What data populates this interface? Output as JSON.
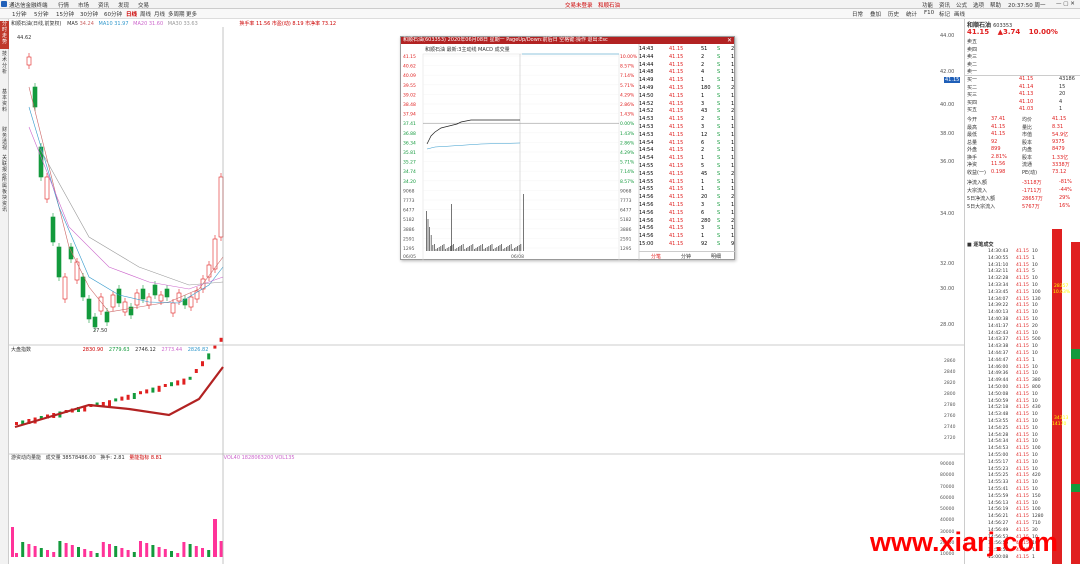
{
  "titlebar": {
    "app": "通达信金融终端",
    "menus": [
      "行情",
      "市场",
      "资讯",
      "发现",
      "交易"
    ],
    "tab_active": "交易未登录",
    "tab_other": "和顺石油",
    "right": [
      "功能",
      "资讯",
      "公式",
      "选项",
      "帮助"
    ],
    "time": "20:37:50 周一"
  },
  "toolbar": {
    "periods": [
      "1分钟",
      "5分钟",
      "15分钟",
      "30分钟",
      "60分钟",
      "日线",
      "周线",
      "月线",
      "多周期",
      "更多"
    ],
    "active": "日线",
    "right": [
      "日常",
      "叠加",
      "历史",
      "统计",
      "F10",
      "标记",
      "画线"
    ]
  },
  "stock": {
    "name": "和顺石油",
    "code": "603353",
    "price": "41.15",
    "change": "3.74",
    "pct": "10.00%"
  },
  "leftbar": {
    "tabs": [
      "分时走势",
      "技术分析",
      "基本资料",
      "财务透视",
      "关联报价",
      "所属板块",
      "资讯"
    ]
  },
  "main_chart": {
    "label": "和顺石油(日线,前复权)",
    "ma": [
      {
        "name": "MA5",
        "value": "34.24",
        "color": "#c66"
      },
      {
        "name": "MA10",
        "value": "31.97",
        "color": "#39c"
      },
      {
        "name": "MA20",
        "value": "31.60",
        "color": "#c6c"
      },
      {
        "name": "MA30",
        "value": "33.63",
        "color": "#999"
      }
    ],
    "right_info": "换手率 11.56  市盈(动) 8.19  市净率 73.12",
    "high_label": "44.62",
    "low_label": "27.50",
    "yaxis": [
      "44.00",
      "42.00",
      "40.00",
      "38.00",
      "36.00",
      "34.00",
      "32.00",
      "30.00",
      "28.00"
    ],
    "cur": "41.15"
  },
  "index_chart": {
    "label": "大盘指数",
    "v1": "2830.90",
    "v2": "2779.63",
    "v3": "2746.12",
    "v4": "2773.44",
    "v5": "2826.82",
    "yaxis": [
      "2860",
      "2840",
      "2820",
      "2800",
      "2780",
      "2760",
      "2740",
      "2720",
      "2700"
    ]
  },
  "vol_chart": {
    "label": "游资动向量能",
    "v1": "成交量",
    "v2": "38578486.00",
    "v3": "换手:",
    "v4": "2.81",
    "v5": "量能指标",
    "v6": "8.81",
    "v7": "VOL40",
    "v8": "1828063200",
    "v9": "VOL135",
    "yaxis": [
      "90000",
      "80000",
      "70000",
      "60000",
      "50000",
      "40000",
      "30000",
      "20000",
      "10000"
    ]
  },
  "popup": {
    "title": "和顺石油(603353) 2020年06月08日 星期一 PageUp/Down:前后日 空格键:操作 退出:Esc",
    "legend": "和顺石油  最新:3主动线  MACD  成交量",
    "ylabels": [
      {
        "v": "41.15",
        "p": "10.00%"
      },
      {
        "v": "40.62",
        "p": "8.57%"
      },
      {
        "v": "40.09",
        "p": "7.14%"
      },
      {
        "v": "39.55",
        "p": "5.71%"
      },
      {
        "v": "39.02",
        "p": "4.29%"
      },
      {
        "v": "38.48",
        "p": "2.86%"
      },
      {
        "v": "37.94",
        "p": "1.43%"
      },
      {
        "v": "37.41",
        "p": "0.00%"
      },
      {
        "v": "36.88",
        "p": "1.43%"
      },
      {
        "v": "36.34",
        "p": "2.86%"
      },
      {
        "v": "35.81",
        "p": "4.29%"
      },
      {
        "v": "35.27",
        "p": "5.71%"
      },
      {
        "v": "34.74",
        "p": "7.14%"
      },
      {
        "v": "34.20",
        "p": "8.57%"
      },
      {
        "v": "9068",
        "p": "9068"
      },
      {
        "v": "7773",
        "p": "7773"
      },
      {
        "v": "6477",
        "p": "6477"
      },
      {
        "v": "5182",
        "p": "5182"
      },
      {
        "v": "3886",
        "p": "3886"
      },
      {
        "v": "2591",
        "p": "2591"
      },
      {
        "v": "1295",
        "p": "1295"
      }
    ],
    "xlabels": [
      "06/05",
      "06/08"
    ],
    "ticks": [
      [
        "14:43",
        "41.15",
        "51",
        "S",
        "2"
      ],
      [
        "14:44",
        "41.15",
        "2",
        "S",
        "1"
      ],
      [
        "14:44",
        "41.15",
        "2",
        "S",
        "1"
      ],
      [
        "14:48",
        "41.15",
        "4",
        "S",
        "1"
      ],
      [
        "14:49",
        "41.15",
        "1",
        "S",
        "1"
      ],
      [
        "14:49",
        "41.15",
        "180",
        "S",
        "2"
      ],
      [
        "14:50",
        "41.15",
        "1",
        "S",
        "1"
      ],
      [
        "14:52",
        "41.15",
        "3",
        "S",
        "1"
      ],
      [
        "14:52",
        "41.15",
        "43",
        "S",
        "2"
      ],
      [
        "14:53",
        "41.15",
        "2",
        "S",
        "1"
      ],
      [
        "14:53",
        "41.15",
        "3",
        "S",
        "1"
      ],
      [
        "14:53",
        "41.15",
        "12",
        "S",
        "1"
      ],
      [
        "14:54",
        "41.15",
        "6",
        "S",
        "1"
      ],
      [
        "14:54",
        "41.15",
        "2",
        "S",
        "1"
      ],
      [
        "14:54",
        "41.15",
        "1",
        "S",
        "1"
      ],
      [
        "14:55",
        "41.15",
        "5",
        "S",
        "1"
      ],
      [
        "14:55",
        "41.15",
        "45",
        "S",
        "2"
      ],
      [
        "14:55",
        "41.15",
        "1",
        "S",
        "1"
      ],
      [
        "14:55",
        "41.15",
        "1",
        "S",
        "1"
      ],
      [
        "14:56",
        "41.15",
        "20",
        "S",
        "2"
      ],
      [
        "14:56",
        "41.15",
        "3",
        "S",
        "1"
      ],
      [
        "14:56",
        "41.15",
        "6",
        "S",
        "1"
      ],
      [
        "14:56",
        "41.15",
        "280",
        "S",
        "2"
      ],
      [
        "14:56",
        "41.15",
        "3",
        "S",
        "1"
      ],
      [
        "14:56",
        "41.15",
        "1",
        "S",
        "1"
      ],
      [
        "15:00",
        "41.15",
        "92",
        "S",
        "9"
      ]
    ],
    "buttons": [
      "分笔",
      "分钟",
      "明细"
    ]
  },
  "orderbook": {
    "sell": [
      {
        "l": "卖五",
        "p": "",
        "v": ""
      },
      {
        "l": "卖四",
        "p": "",
        "v": ""
      },
      {
        "l": "卖三",
        "p": "",
        "v": ""
      },
      {
        "l": "卖二",
        "p": "",
        "v": ""
      },
      {
        "l": "卖一",
        "p": "",
        "v": ""
      }
    ],
    "buy": [
      {
        "l": "买一",
        "p": "41.15",
        "v": "43186"
      },
      {
        "l": "买二",
        "p": "41.14",
        "v": "15"
      },
      {
        "l": "买三",
        "p": "41.13",
        "v": "20"
      },
      {
        "l": "买四",
        "p": "41.10",
        "v": "4"
      },
      {
        "l": "买五",
        "p": "41.03",
        "v": "1"
      }
    ]
  },
  "stats": [
    [
      "今开",
      "37.41",
      "均价",
      "41.15"
    ],
    [
      "最高",
      "41.15",
      "量比",
      "8.31"
    ],
    [
      "最低",
      "41.15",
      "市值",
      "54.9亿"
    ],
    [
      "总量",
      "92",
      "股本",
      "9375"
    ],
    [
      "外盘",
      "899",
      "内盘",
      "8479"
    ],
    [
      "换手",
      "2.81%",
      "股本",
      "1.33亿"
    ],
    [
      "净资",
      "11.56",
      "流通",
      "3338万"
    ],
    [
      "收益(一)",
      "0.198",
      "PE(动)",
      "73.12"
    ]
  ],
  "flows": [
    [
      "净流入额",
      "-3118万",
      "-81%"
    ],
    [
      "大宗流入",
      "-1711万",
      "-44%"
    ],
    [
      "5日净流入额",
      "28657万",
      "29%"
    ],
    [
      "5日大宗流入",
      "5767万",
      "16%"
    ]
  ],
  "trades_title": "逐笔成交",
  "trades": [
    [
      "14:30:43",
      "41.15",
      "10"
    ],
    [
      "14:30:55",
      "41.15",
      "1"
    ],
    [
      "14:31:10",
      "41.15",
      "10"
    ],
    [
      "14:32:11",
      "41.15",
      "5"
    ],
    [
      "14:32:28",
      "41.15",
      "10"
    ],
    [
      "14:33:34",
      "41.15",
      "10"
    ],
    [
      "14:33:45",
      "41.15",
      "100"
    ],
    [
      "14:34:07",
      "41.15",
      "130"
    ],
    [
      "14:39:22",
      "41.15",
      "10"
    ],
    [
      "14:40:13",
      "41.15",
      "10"
    ],
    [
      "14:40:38",
      "41.15",
      "10"
    ],
    [
      "14:41:37",
      "41.15",
      "20"
    ],
    [
      "14:42:43",
      "41.15",
      "10"
    ],
    [
      "14:43:37",
      "41.15",
      "500"
    ],
    [
      "14:43:38",
      "41.15",
      "10"
    ],
    [
      "14:44:37",
      "41.15",
      "10"
    ],
    [
      "14:44:47",
      "41.15",
      "1"
    ],
    [
      "14:46:00",
      "41.15",
      "10"
    ],
    [
      "14:49:36",
      "41.15",
      "10"
    ],
    [
      "14:49:44",
      "41.15",
      "380"
    ],
    [
      "14:50:00",
      "41.15",
      "800"
    ],
    [
      "14:50:08",
      "41.15",
      "10"
    ],
    [
      "14:50:59",
      "41.15",
      "10"
    ],
    [
      "14:52:18",
      "41.15",
      "430"
    ],
    [
      "14:53:48",
      "41.15",
      "10"
    ],
    [
      "14:53:55",
      "41.15",
      "10"
    ],
    [
      "14:54:25",
      "41.15",
      "10"
    ],
    [
      "14:54:28",
      "41.15",
      "10"
    ],
    [
      "14:54:34",
      "41.15",
      "10"
    ],
    [
      "14:54:53",
      "41.15",
      "100"
    ],
    [
      "14:55:00",
      "41.15",
      "10"
    ],
    [
      "14:55:17",
      "41.15",
      "10"
    ],
    [
      "14:55:23",
      "41.15",
      "10"
    ],
    [
      "14:55:25",
      "41.15",
      "420"
    ],
    [
      "14:55:33",
      "41.15",
      "10"
    ],
    [
      "14:55:41",
      "41.15",
      "10"
    ],
    [
      "14:55:59",
      "41.15",
      "150"
    ],
    [
      "14:56:13",
      "41.15",
      "10"
    ],
    [
      "14:56:19",
      "41.15",
      "100"
    ],
    [
      "14:56:21",
      "41.15",
      "1280"
    ],
    [
      "14:56:27",
      "41.15",
      "710"
    ],
    [
      "14:56:49",
      "41.15",
      "30"
    ],
    [
      "14:56:53",
      "41.15",
      "10"
    ],
    [
      "14:56:56",
      "41.15",
      "10"
    ],
    [
      "14:56:58",
      "41.15",
      "1"
    ],
    [
      "15:00:08",
      "41.15",
      "1"
    ]
  ],
  "right_bars": {
    "label1": "28357\n10.63%",
    "label2": "34313\n14170"
  },
  "watermark": "www.xiarj.com"
}
